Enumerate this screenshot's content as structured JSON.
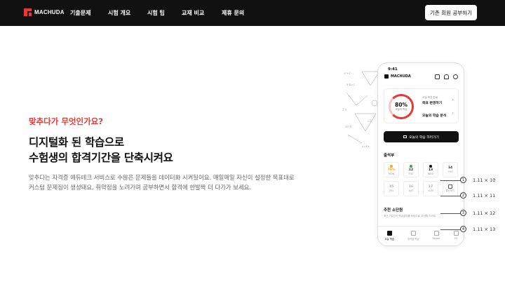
{
  "header": {
    "logo_text": "MACHUDA",
    "nav": [
      {
        "label": "기출문제"
      },
      {
        "label": "시험 개요"
      },
      {
        "label": "시험 팁"
      },
      {
        "label": "교재 비교"
      },
      {
        "label": "제휴 문의"
      }
    ],
    "cta_label": "기존 회원 공부하기"
  },
  "hero": {
    "kicker": "맞추다가 무엇인가요?",
    "title_line1": "디지털화 된 학습으로",
    "title_line2": "수험생의 합격기간을 단축시켜요",
    "desc_line1": "맞추다는 자격증 에듀테크 서비스로 수많은 문제들을 데이터화 시켜뒀어요. 매일매일 자신이 설정한 목표대로",
    "desc_line2": "커스텀 문제집이 생성돼요. 취약점을 노려가며 공부하면서 합격에 한발짝 더 다가가 보세요."
  },
  "phone": {
    "status_time": "9:41",
    "logo_text": "MACHUDA",
    "progress": {
      "percent_label": "80%",
      "percent_value": 80,
      "caption": "오늘의 학습"
    },
    "card_small": "오늘 목표 완료",
    "card_goal": "목표 변경하기",
    "card_analysis": "오늘의 학습 분석",
    "study_button": "오늘의 학습 하러가기",
    "attendance_title": "출석부",
    "days": [
      {
        "num": "79%",
        "label": "MON",
        "dot": "#f5a623"
      },
      {
        "num": "12",
        "label": "TUE",
        "dot": "#43a047"
      },
      {
        "num": "13",
        "label": "WED",
        "dot": "#111111"
      },
      {
        "num": "14",
        "label": "THU",
        "dot": ""
      },
      {
        "num": "15",
        "label": "FRI",
        "dot": ""
      },
      {
        "num": "16",
        "label": "SAT",
        "dot": ""
      },
      {
        "num": "17",
        "label": "SUN",
        "dot": ""
      },
      {
        "num": "",
        "label": "월간보기",
        "dot": ""
      }
    ],
    "recommend_title": "추천 소단원",
    "recommend_sub": "최근 7일간의 학습결과를 바탕으로 추천해 드려요",
    "tabs": [
      {
        "label": "오늘 학습"
      },
      {
        "label": "취약점 학습"
      },
      {
        "label": "Report"
      },
      {
        "label": "MY"
      }
    ]
  },
  "annotations": [
    {
      "num": "1",
      "label": "1.11 × 10"
    },
    {
      "num": "2",
      "label": "1.11 × 11"
    },
    {
      "num": "3",
      "label": "1.11 × 12"
    },
    {
      "num": "4",
      "label": "1.11 × 13"
    }
  ],
  "colors": {
    "accent": "#e53935",
    "dark": "#111111"
  }
}
